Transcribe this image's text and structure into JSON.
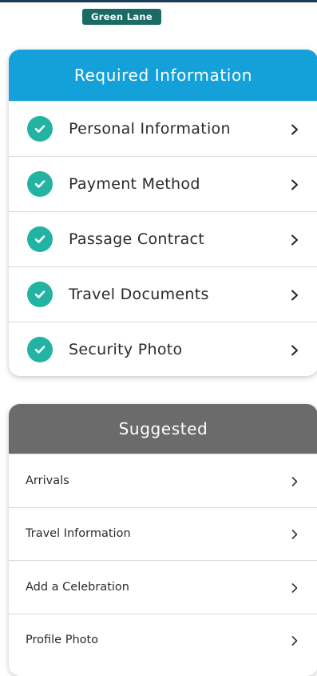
{
  "header": {
    "badge_label": "Green Lane"
  },
  "required": {
    "title": "Required Information",
    "items": [
      {
        "label": "Personal Information",
        "status": "complete"
      },
      {
        "label": "Payment Method",
        "status": "complete"
      },
      {
        "label": "Passage Contract",
        "status": "complete"
      },
      {
        "label": "Travel Documents",
        "status": "complete"
      },
      {
        "label": "Security Photo",
        "status": "complete"
      }
    ]
  },
  "suggested": {
    "title": "Suggested",
    "items": [
      {
        "label": "Arrivals"
      },
      {
        "label": "Travel Information"
      },
      {
        "label": "Add a Celebration"
      },
      {
        "label": "Profile Photo"
      }
    ]
  },
  "colors": {
    "required_header": "#14a0d8",
    "suggested_header": "#6b6b6b",
    "check_complete": "#22b3a3",
    "badge": "#1a6b65"
  },
  "icons": {
    "check": "check-circle-icon",
    "chevron": "chevron-right-icon"
  }
}
